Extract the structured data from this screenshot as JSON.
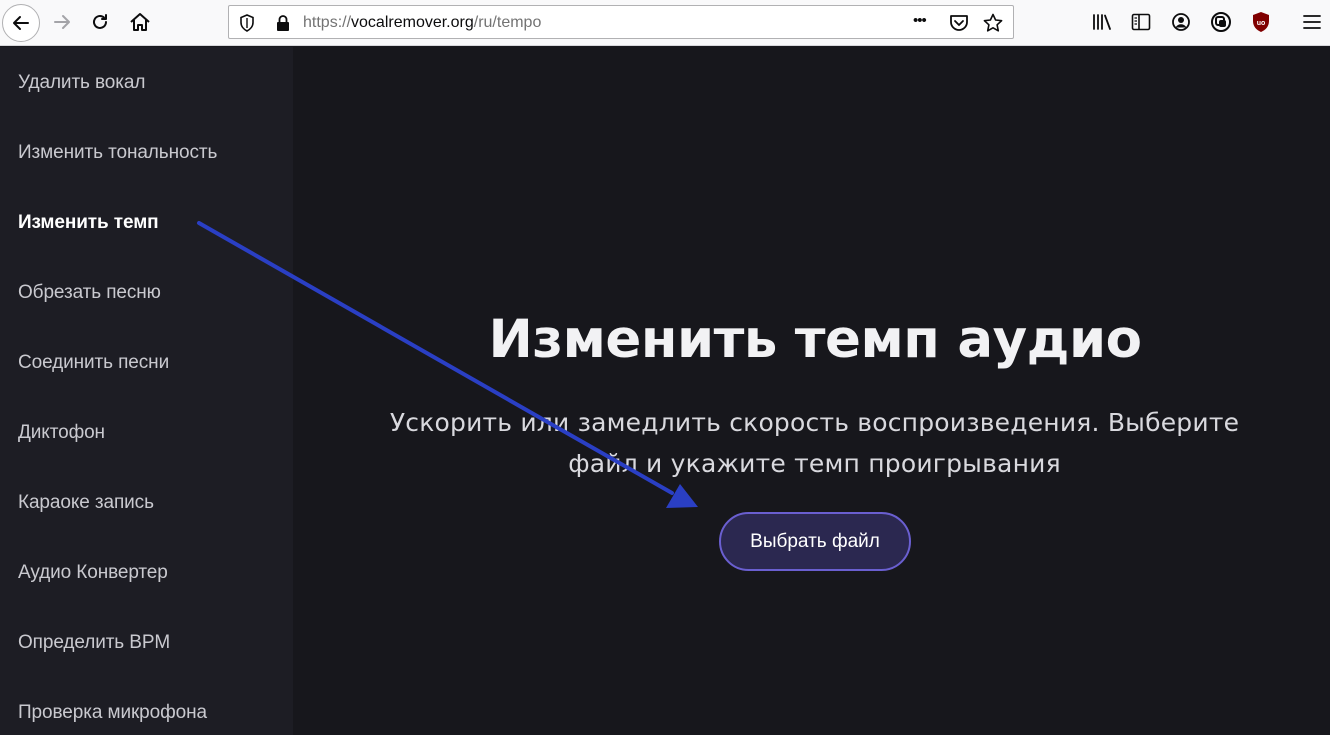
{
  "browser": {
    "url_prefix": "https://",
    "url_host": "vocalremover.org",
    "url_path": "/ru/tempo",
    "more_label": "•••"
  },
  "sidebar": {
    "items": [
      {
        "label": "Удалить вокал",
        "active": false
      },
      {
        "label": "Изменить тональность",
        "active": false
      },
      {
        "label": "Изменить темп",
        "active": true
      },
      {
        "label": "Обрезать песню",
        "active": false
      },
      {
        "label": "Соединить песни",
        "active": false
      },
      {
        "label": "Диктофон",
        "active": false
      },
      {
        "label": "Караоке запись",
        "active": false
      },
      {
        "label": "Аудио Конвертер",
        "active": false
      },
      {
        "label": "Определить BPM",
        "active": false
      },
      {
        "label": "Проверка микрофона",
        "active": false
      }
    ]
  },
  "main": {
    "title": "Изменить темп аудио",
    "subtitle_line1": "Ускорить или замедлить скорость воспроизведения. Выберите",
    "subtitle_line2": "файл и укажите темп проигрывания",
    "choose_button": "Выбрать файл"
  },
  "colors": {
    "annotation_arrow": "#2a3fc4",
    "button_border": "#6a5fd0",
    "button_fill": "#2b2850"
  }
}
